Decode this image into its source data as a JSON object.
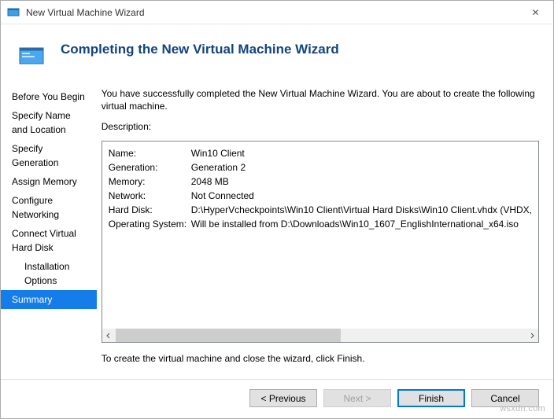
{
  "window": {
    "title": "New Virtual Machine Wizard",
    "close_glyph": "✕"
  },
  "header": {
    "title": "Completing the New Virtual Machine Wizard"
  },
  "sidebar": {
    "items": [
      {
        "label": "Before You Begin",
        "sub": false,
        "selected": false
      },
      {
        "label": "Specify Name and Location",
        "sub": false,
        "selected": false
      },
      {
        "label": "Specify Generation",
        "sub": false,
        "selected": false
      },
      {
        "label": "Assign Memory",
        "sub": false,
        "selected": false
      },
      {
        "label": "Configure Networking",
        "sub": false,
        "selected": false
      },
      {
        "label": "Connect Virtual Hard Disk",
        "sub": false,
        "selected": false
      },
      {
        "label": "Installation Options",
        "sub": true,
        "selected": false
      },
      {
        "label": "Summary",
        "sub": false,
        "selected": true
      }
    ]
  },
  "content": {
    "intro": "You have successfully completed the New Virtual Machine Wizard. You are about to create the following virtual machine.",
    "description_label": "Description:",
    "rows": [
      {
        "key": "Name:",
        "value": "Win10 Client"
      },
      {
        "key": "Generation:",
        "value": "Generation 2"
      },
      {
        "key": "Memory:",
        "value": "2048 MB"
      },
      {
        "key": "Network:",
        "value": "Not Connected"
      },
      {
        "key": "Hard Disk:",
        "value": "D:\\HyperVcheckpoints\\Win10 Client\\Virtual Hard Disks\\Win10 Client.vhdx (VHDX,"
      },
      {
        "key": "Operating System:",
        "value": "Will be installed from D:\\Downloads\\Win10_1607_EnglishInternational_x64.iso"
      }
    ],
    "closing": "To create the virtual machine and close the wizard, click Finish."
  },
  "buttons": {
    "previous": "< Previous",
    "next": "Next >",
    "finish": "Finish",
    "cancel": "Cancel"
  },
  "watermark": "wsxdn.com"
}
